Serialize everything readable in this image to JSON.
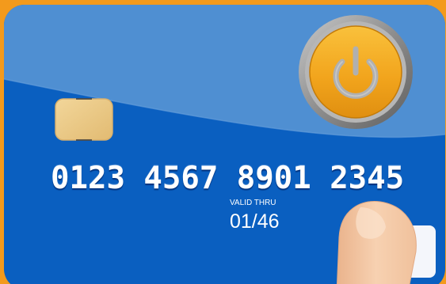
{
  "card": {
    "number": "0123 4567 8901 2345",
    "valid_thru_label": "VALID THRU",
    "expiry": "01/46"
  },
  "icons": {
    "power_button": "power-icon",
    "chip": "chip-icon",
    "finger": "finger-icon"
  },
  "colors": {
    "border": "#f39a1c",
    "card_blue": "#0a5fc0",
    "card_highlight": "#4f8fd2",
    "power_orange": "#f3a820",
    "power_ring": "#9a9a9a",
    "chip_gold": "#ecc989",
    "skin": "#f4c8a4"
  }
}
